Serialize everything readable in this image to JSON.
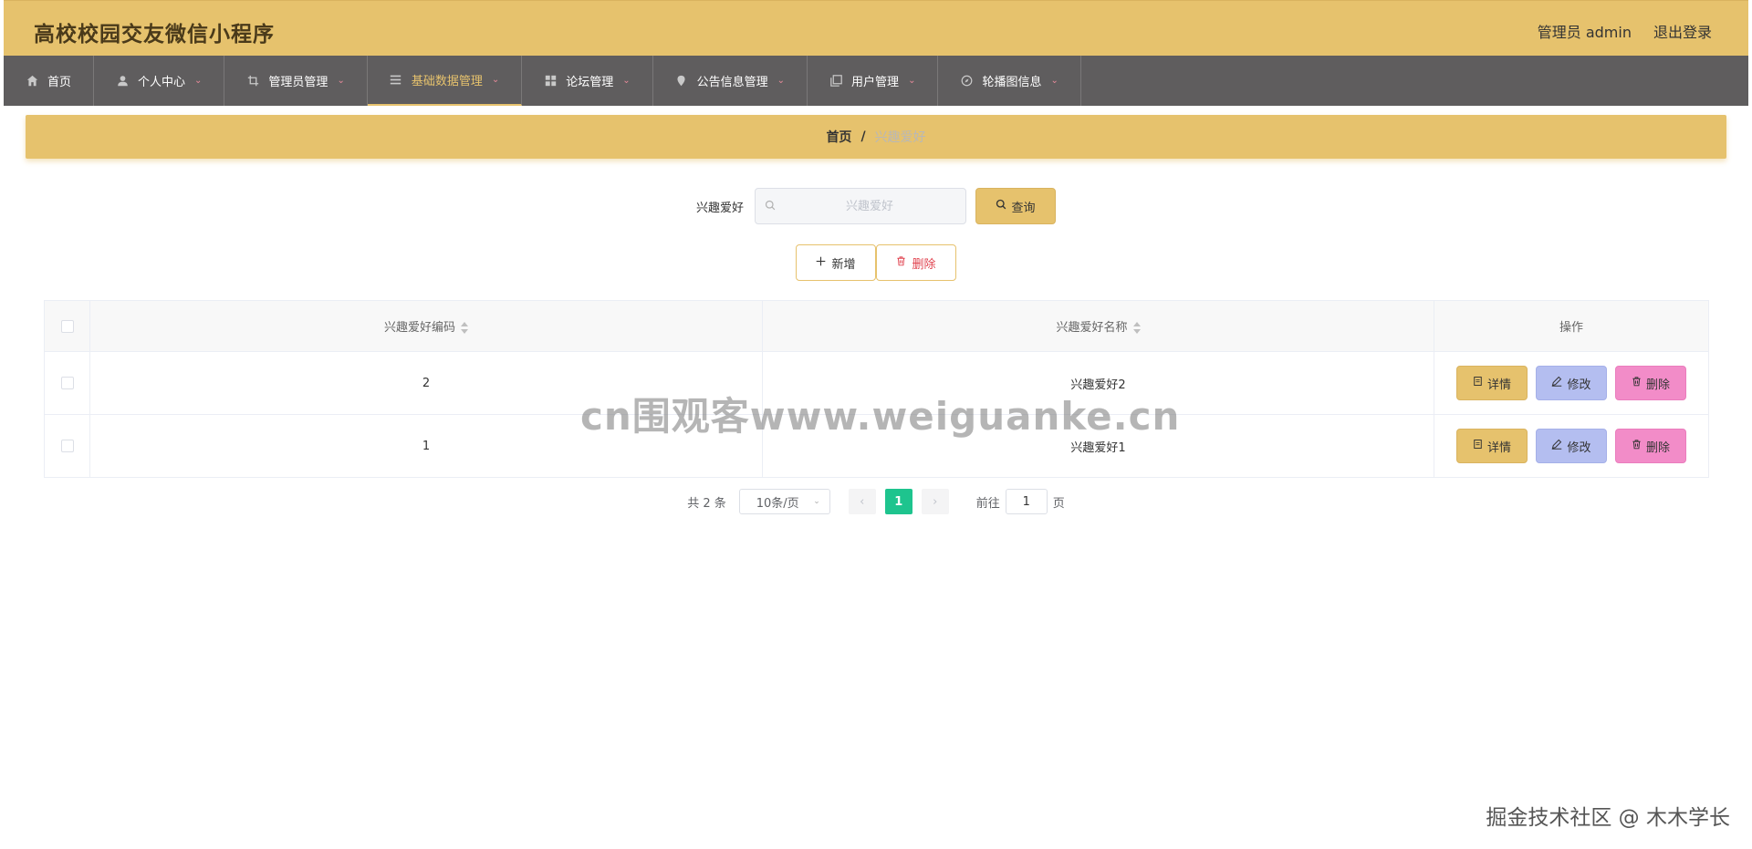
{
  "header": {
    "title": "高校校园交友微信小程序",
    "admin_label": "管理员 admin",
    "logout_label": "退出登录"
  },
  "nav": [
    {
      "label": "首页",
      "icon": "home-icon"
    },
    {
      "label": "个人中心",
      "icon": "user-icon"
    },
    {
      "label": "管理员管理",
      "icon": "crop-icon"
    },
    {
      "label": "基础数据管理",
      "icon": "list-icon",
      "active": true
    },
    {
      "label": "论坛管理",
      "icon": "grid-icon"
    },
    {
      "label": "公告信息管理",
      "icon": "pin-icon"
    },
    {
      "label": "用户管理",
      "icon": "copy-icon"
    },
    {
      "label": "轮播图信息",
      "icon": "compass-icon"
    }
  ],
  "breadcrumb": {
    "home": "首页",
    "separator": "/",
    "current": "兴趣爱好"
  },
  "search": {
    "label": "兴趣爱好",
    "placeholder": "兴趣爱好",
    "button_label": "查询"
  },
  "actions": {
    "add_label": "新增",
    "delete_label": "删除"
  },
  "table": {
    "columns": [
      "兴趣爱好编码",
      "兴趣爱好名称",
      "操作"
    ],
    "rows": [
      {
        "code": "2",
        "name": "兴趣爱好2"
      },
      {
        "code": "1",
        "name": "兴趣爱好1"
      }
    ],
    "row_actions": {
      "detail": "详情",
      "edit": "修改",
      "delete": "删除"
    }
  },
  "pagination": {
    "total": "共 2 条",
    "page_size": "10条/页",
    "current_page": "1",
    "goto_prefix": "前往",
    "goto_value": "1",
    "goto_suffix": "页"
  },
  "watermarks": {
    "center": "cn围观客www.weiguanke.cn",
    "corner": "掘金技术社区 @ 木木学长"
  },
  "colors": {
    "accent": "#e6c26d",
    "nav_bg": "#5f5d5e",
    "page_active": "#1ec48e",
    "edit_btn": "#b4bef0",
    "delete_btn": "#f28cc8",
    "danger_text": "#e0424e"
  }
}
